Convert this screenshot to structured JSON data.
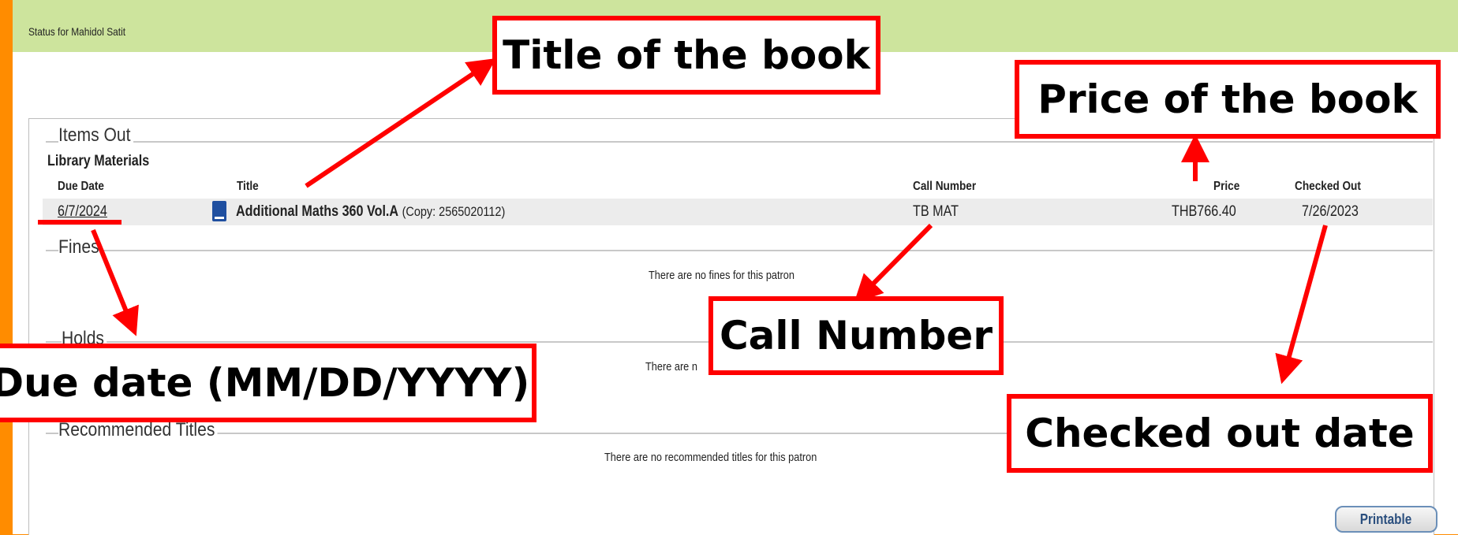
{
  "header": {
    "title": "Status for Mahidol Satit"
  },
  "items_out": {
    "heading": "Items Out",
    "subheading": "Library Materials",
    "columns": {
      "due_date": "Due Date",
      "title": "Title",
      "call_number": "Call Number",
      "price": "Price",
      "checked_out": "Checked Out"
    },
    "rows": [
      {
        "due_date": "6/7/2024",
        "title": "Additional Maths 360 Vol.A",
        "copy": "(Copy: 2565020112)",
        "call_number": "TB MAT",
        "price": "THB766.40",
        "checked_out": "7/26/2023"
      }
    ]
  },
  "fines": {
    "heading": "Fines",
    "message": "There are no fines for this patron"
  },
  "holds": {
    "heading": "Holds",
    "message": "There are n"
  },
  "recommended": {
    "heading": "Recommended Titles",
    "message": "There are no recommended titles for this patron"
  },
  "printable_label": "Printable",
  "annotations": {
    "title": "Title of the book",
    "price": "Price of the book",
    "call_number": "Call Number",
    "due_date": "Due date (MM/DD/YYYY)",
    "checked_out": "Checked out date"
  },
  "colors": {
    "border": "#ff8c00",
    "header": "#cde49d",
    "callout": "#ff0000",
    "row": "#ececec"
  }
}
